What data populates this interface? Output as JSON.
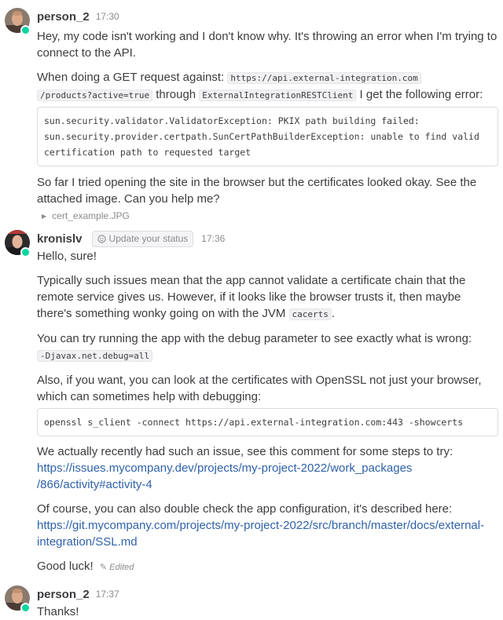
{
  "posts": [
    {
      "user": "person_2",
      "time": "17:30",
      "p1": "Hey, my code isn't working and I don't know why. It's throwing an error when I'm trying to connect to the API.",
      "p2_prefix": "When doing a GET request against:",
      "url_part1": "https://api.external-integration.com",
      "url_part2": "/products?active=true",
      "through": "through",
      "client": "ExternalIntegrationRESTClient",
      "p2_suffix": "I get the following error:",
      "error_code": "sun.security.validator.ValidatorException: PKIX path building failed:\nsun.security.provider.certpath.SunCertPathBuilderException: unable to find valid\ncertification path to requested target",
      "p3": "So far I tried opening the site in the browser but the certificates looked okay. See the attached image. Can you help me?",
      "attachment": "cert_example.JPG"
    },
    {
      "user": "kronislv",
      "status_button": "Update your status",
      "time": "17:36",
      "p1": "Hello, sure!",
      "p2": "Typically such issues mean that the app cannot validate a certificate chain that the remote service gives us. However, if it looks like the browser trusts it, then maybe there's something wonky going on with the JVM",
      "p2_code": "cacerts",
      "p2_end": ".",
      "p3": "You can try running the app with the debug parameter to see exactly what is wrong:",
      "p3_code": "-Djavax.net.debug=all",
      "p4": "Also, if you want, you can look at the certificates with OpenSSL not just your browser, which can sometimes help with debugging:",
      "openssl_code": "openssl s_client -connect https://api.external-integration.com:443 -showcerts",
      "p5": "We actually recently had such an issue, see this comment for some steps to try:",
      "link1_a": "https://issues.mycompany.dev/projects/my-project-2022/work_packages",
      "link1_b": "/866/activity#activity-4",
      "p6": "Of course, you can also double check the app configuration, it's described here:",
      "link2_a": "https://git.mycompany.com/projects/my-project-2022/src/branch/master/docs/external-",
      "link2_b": "integration/SSL.md",
      "p7": "Good luck!",
      "edited": "Edited"
    },
    {
      "user": "person_2",
      "time": "17:37",
      "p1": "Thanks!"
    }
  ],
  "colors": {
    "link": "#2f62a8",
    "status_online": "#06d6a0",
    "text": "#3d3c40",
    "muted": "#8b8b90"
  }
}
